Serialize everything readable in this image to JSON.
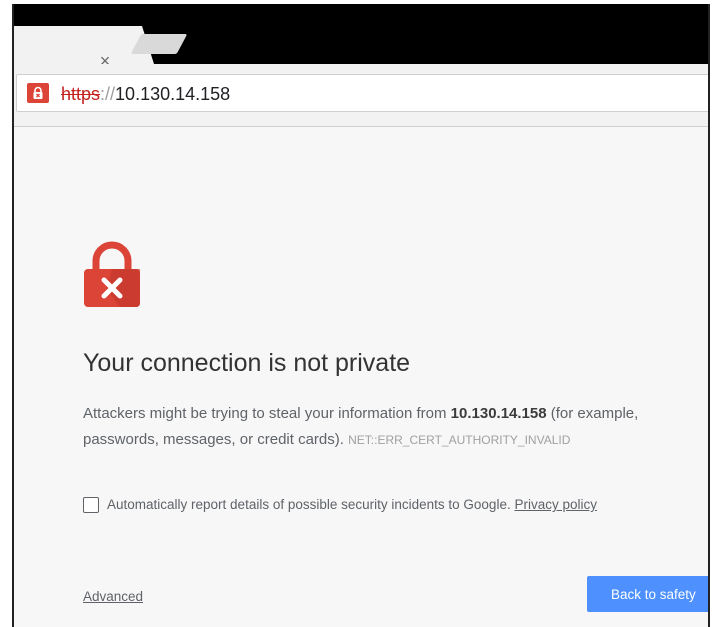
{
  "browser": {
    "tab_close_glyph": "×",
    "address_bar": {
      "scheme": "https",
      "separator": "://",
      "host": "10.130.14.158",
      "security_state": "not-secure",
      "security_icon": "lock-error-icon",
      "security_color": "#db4437"
    }
  },
  "interstitial": {
    "icon": "lock-error-icon",
    "icon_color": "#db4437",
    "heading": "Your connection is not private",
    "explanation": {
      "before_host": "Attackers might be trying to steal your information from ",
      "host": "10.130.14.158",
      "after_host": " (for example, passwords, messages, or credit cards).",
      "error_code": "NET::ERR_CERT_AUTHORITY_INVALID"
    },
    "report": {
      "label": "Automatically report details of possible security incidents to Google.",
      "checked": false,
      "privacy_link": "Privacy policy"
    },
    "advanced_link": "Advanced",
    "back_button": "Back to safety",
    "primary_color": "#4d90fe"
  }
}
